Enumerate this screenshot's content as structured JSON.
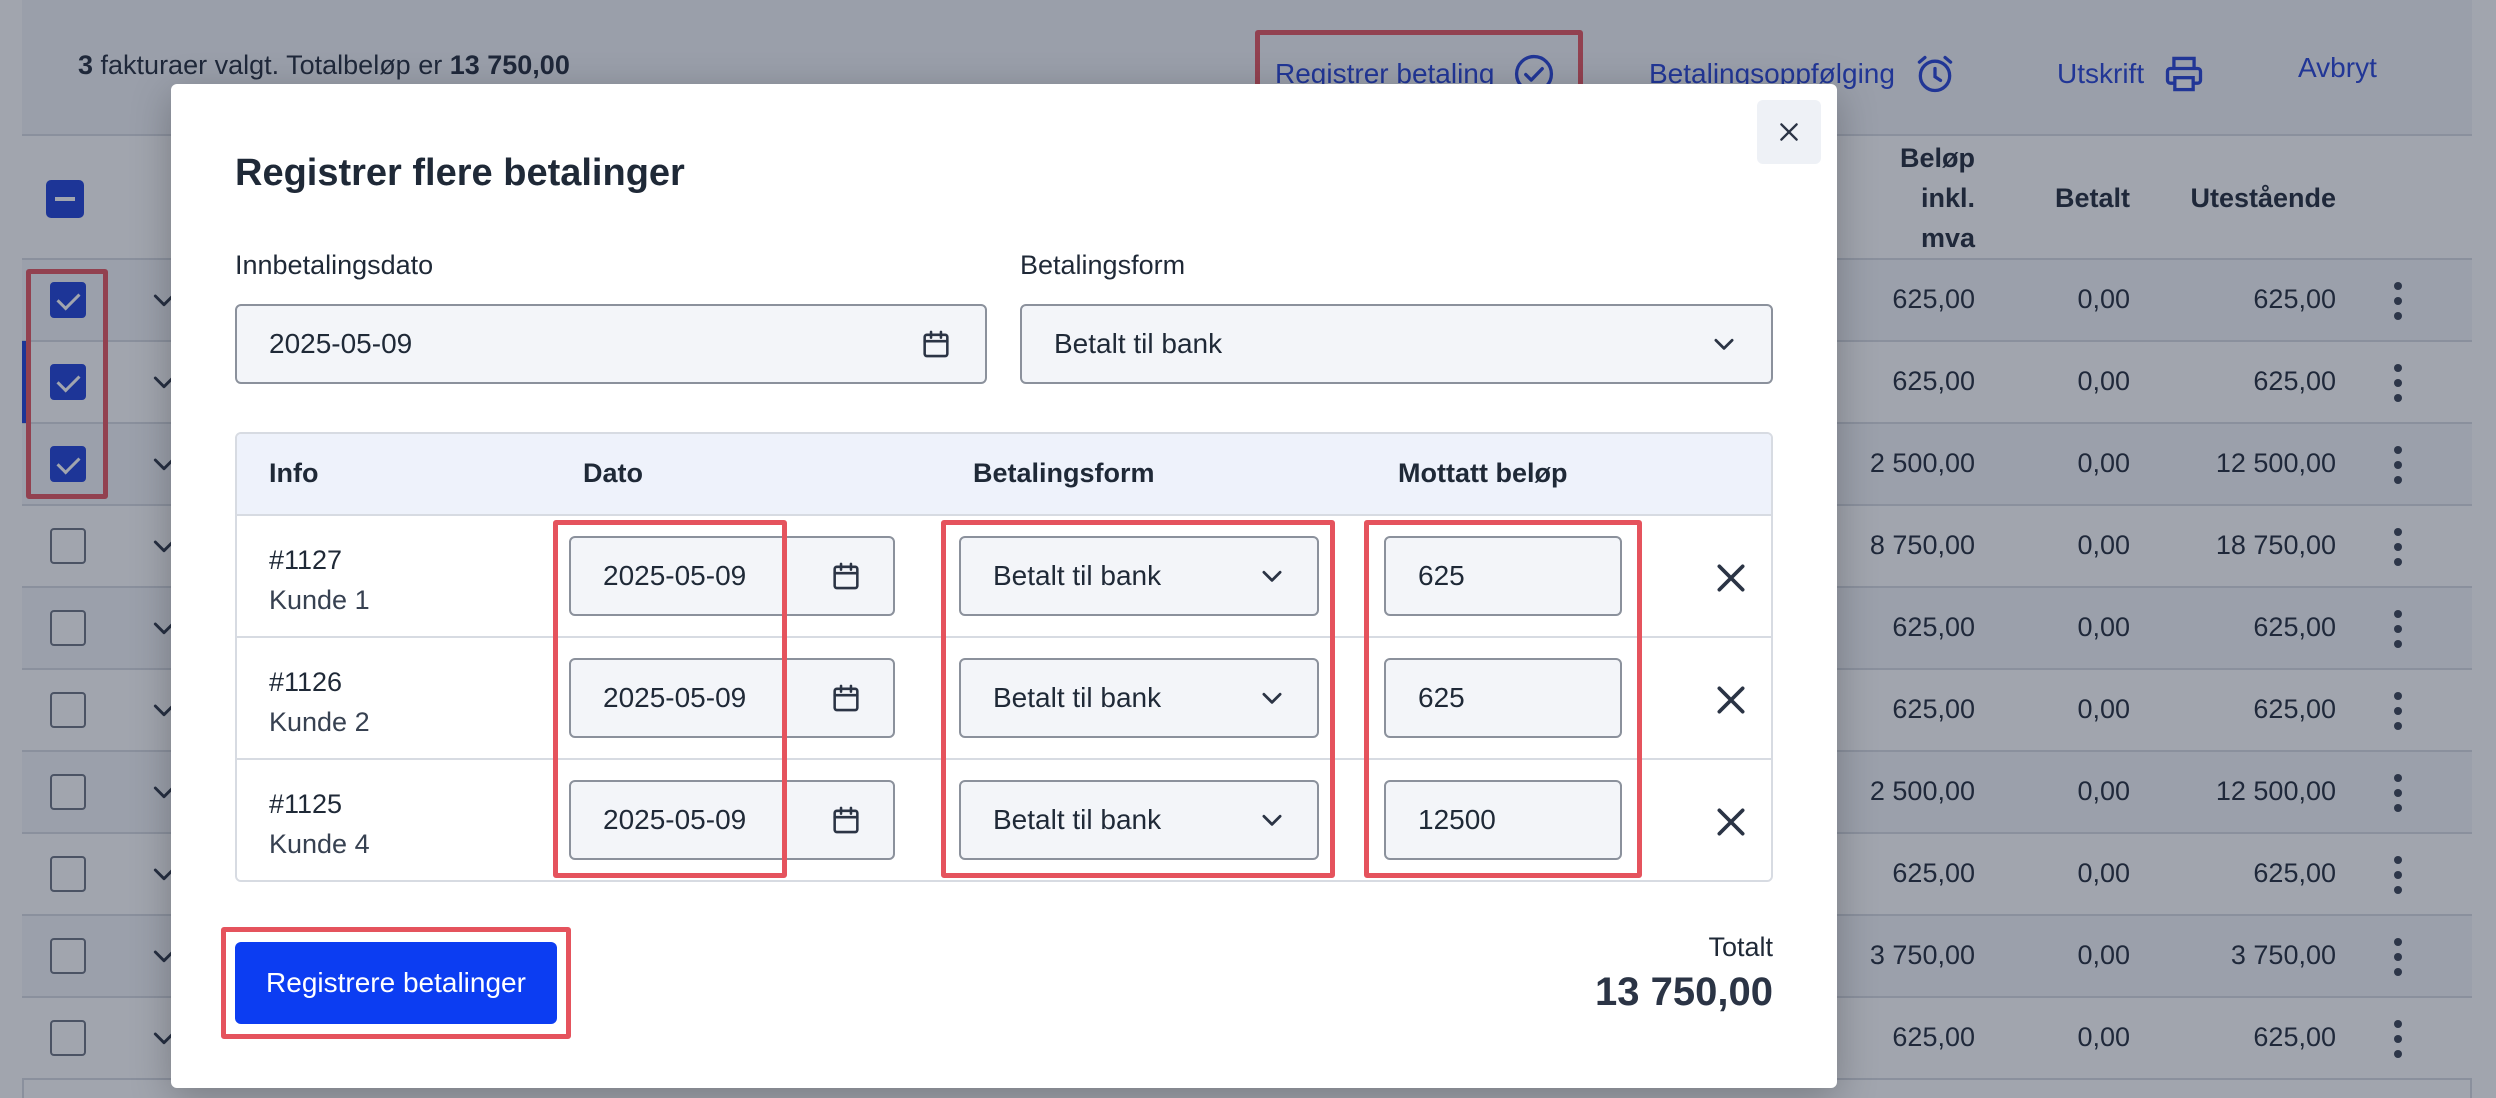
{
  "toolbar": {
    "count": "3",
    "selection_text": " fakturaer valgt. Totalbeløp er ",
    "total": "13 750,00",
    "register_payment": "Registrer betaling",
    "payment_followup": "Betalingsoppfølging",
    "print": "Utskrift",
    "cancel": "Avbryt"
  },
  "table": {
    "headers": {
      "amount_line1": "Beløp",
      "amount_line2": "inkl.",
      "amount_line3": "mva",
      "paid": "Betalt",
      "outstanding": "Utestående"
    },
    "rows": [
      {
        "checked": true,
        "amount": "625,00",
        "paid": "0,00",
        "outstanding": "625,00"
      },
      {
        "checked": true,
        "amount": "625,00",
        "paid": "0,00",
        "outstanding": "625,00"
      },
      {
        "checked": true,
        "amount": "2 500,00",
        "paid": "0,00",
        "outstanding": "12 500,00"
      },
      {
        "checked": false,
        "amount": "8 750,00",
        "paid": "0,00",
        "outstanding": "18 750,00"
      },
      {
        "checked": false,
        "amount": "625,00",
        "paid": "0,00",
        "outstanding": "625,00"
      },
      {
        "checked": false,
        "amount": "625,00",
        "paid": "0,00",
        "outstanding": "625,00"
      },
      {
        "checked": false,
        "amount": "2 500,00",
        "paid": "0,00",
        "outstanding": "12 500,00"
      },
      {
        "checked": false,
        "amount": "625,00",
        "paid": "0,00",
        "outstanding": "625,00"
      },
      {
        "checked": false,
        "amount": "3 750,00",
        "paid": "0,00",
        "outstanding": "3 750,00"
      },
      {
        "checked": false,
        "amount": "625,00",
        "paid": "0,00",
        "outstanding": "625,00"
      }
    ]
  },
  "modal": {
    "title": "Registrer flere betalinger",
    "date_label": "Innbetalingsdato",
    "date_value": "2025-05-09",
    "method_label": "Betalingsform",
    "method_value": "Betalt til bank",
    "columns": {
      "info": "Info",
      "date": "Dato",
      "method": "Betalingsform",
      "amount": "Mottatt beløp"
    },
    "payments": [
      {
        "invoice": "#1127",
        "customer": "Kunde 1",
        "date": "2025-05-09",
        "method": "Betalt til bank",
        "amount": "625"
      },
      {
        "invoice": "#1126",
        "customer": "Kunde 2",
        "date": "2025-05-09",
        "method": "Betalt til bank",
        "amount": "625"
      },
      {
        "invoice": "#1125",
        "customer": "Kunde 4",
        "date": "2025-05-09",
        "method": "Betalt til bank",
        "amount": "12500"
      }
    ],
    "submit": "Registrere betalinger",
    "total_label": "Totalt",
    "total_value": "13 750,00"
  },
  "colors": {
    "accent": "#0c3df2",
    "link": "#2440d6",
    "highlight": "#e5535d"
  },
  "icons": [
    "check-circle-icon",
    "alarm-clock-icon",
    "printer-icon",
    "close-icon",
    "calendar-icon",
    "chevron-down-icon",
    "kebab-menu-icon"
  ]
}
